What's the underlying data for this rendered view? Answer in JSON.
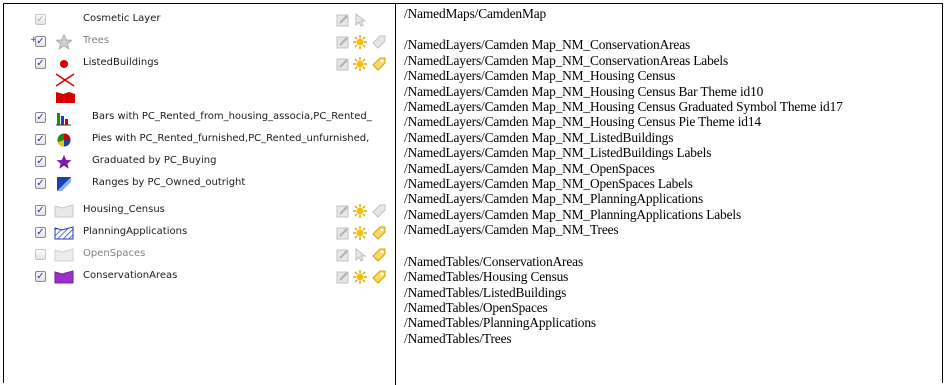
{
  "layers": [
    {
      "label": "Cosmetic Layer",
      "checked": true,
      "icon": "cosmetic-layer-icon"
    },
    {
      "label": "Trees",
      "checked": true,
      "icon": "star-icon",
      "expander": "+"
    },
    {
      "label": "ListedBuildings",
      "checked": true,
      "icon": "red-dot-icon"
    },
    {
      "label": "Bars with PC_Rented_from_housing_associa,PC_Rented_",
      "checked": true,
      "icon": "bar-chart-icon"
    },
    {
      "label": "Pies with PC_Rented_furnished,PC_Rented_unfurnished,",
      "checked": true,
      "icon": "pie-chart-icon"
    },
    {
      "label": "Graduated by PC_Buying",
      "checked": true,
      "icon": "graduated-star-icon"
    },
    {
      "label": "Ranges by PC_Owned_outright",
      "checked": true,
      "icon": "ranges-icon"
    },
    {
      "label": "Housing_Census",
      "checked": true,
      "icon": "region-icon"
    },
    {
      "label": "PlanningApplications",
      "checked": true,
      "icon": "hatched-region-icon"
    },
    {
      "label": "OpenSpaces",
      "checked": false,
      "icon": "region-icon"
    },
    {
      "label": "ConservationAreas",
      "checked": true,
      "icon": "purple-region-icon"
    }
  ],
  "paths": {
    "map": "/NamedMaps/CamdenMap",
    "layers": [
      "/NamedLayers/Camden Map_NM_ConservationAreas",
      "/NamedLayers/Camden Map_NM_ConservationAreas Labels",
      "/NamedLayers/Camden Map_NM_Housing Census",
      "/NamedLayers/Camden Map_NM_Housing Census Bar Theme id10",
      "/NamedLayers/Camden Map_NM_Housing Census Graduated Symbol Theme id17",
      "/NamedLayers/Camden Map_NM_Housing Census Pie Theme id14",
      "/NamedLayers/Camden Map_NM_ListedBuildings",
      "/NamedLayers/Camden Map_NM_ListedBuildings Labels",
      "/NamedLayers/Camden Map_NM_OpenSpaces",
      "/NamedLayers/Camden Map_NM_OpenSpaces Labels",
      "/NamedLayers/Camden Map_NM_PlanningApplications",
      "/NamedLayers/Camden Map_NM_PlanningApplications Labels",
      "/NamedLayers/Camden Map_NM_Trees"
    ],
    "tables": [
      "/NamedTables/ConservationAreas",
      "/NamedTables/Housing Census",
      "/NamedTables/ListedBuildings",
      "/NamedTables/OpenSpaces",
      "/NamedTables/PlanningApplications",
      "/NamedTables/Trees"
    ]
  },
  "colors": {
    "check": "#1d3f8a",
    "red_symbol": "#d40000",
    "purple_region": "#9b30c8",
    "hatch_blue": "#2233cc",
    "tool_gray": "#b8b8b8",
    "tool_gold": "#e0a800"
  }
}
